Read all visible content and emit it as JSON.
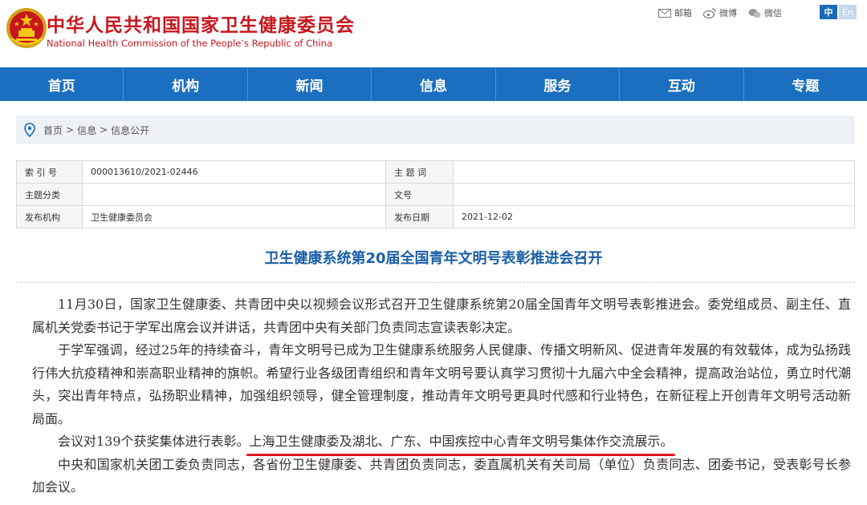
{
  "header": {
    "title_cn": "中华人民共和国国家卫生健康委员会",
    "title_en": "National Health Commission of the People’s Republic of China",
    "links": [
      {
        "label": "邮箱",
        "icon": "mail-icon"
      },
      {
        "label": "微博",
        "icon": "weibo-icon"
      },
      {
        "label": "微信",
        "icon": "wechat-icon"
      }
    ],
    "lang": {
      "cn": "中",
      "en": "En"
    }
  },
  "colors": {
    "brand_red": "#c8161d",
    "nav_blue": "#1b6fc0",
    "title_blue": "#1a5fa8",
    "highlight_red": "#e0141a"
  },
  "nav": [
    "首页",
    "机构",
    "新闻",
    "信息",
    "服务",
    "互动",
    "专题"
  ],
  "breadcrumb": {
    "items": [
      "首页",
      "信息",
      "信息公开"
    ],
    "sep": ">"
  },
  "info": {
    "index_label": "索 引 号",
    "index_value": "000013610/2021-02446",
    "subject_label": "主 题 词",
    "subject_value": "",
    "category_label": "主题分类",
    "category_value": "",
    "docno_label": "文号",
    "docno_value": "",
    "org_label": "发布机构",
    "org_value": "卫生健康委员会",
    "date_label": "发布日期",
    "date_value": "2021-12-02"
  },
  "article": {
    "title": "卫生健康系统第20届全国青年文明号表彰推进会召开",
    "p1": "11月30日，国家卫生健康委、共青团中央以视频会议形式召开卫生健康系统第20届全国青年文明号表彰推进会。委党组成员、副主任、直属机关党委书记于学军出席会议并讲话，共青团中央有关部门负责同志宣读表彰决定。",
    "p2": "于学军强调，经过25年的持续奋斗，青年文明号已成为卫生健康系统服务人民健康、传播文明新风、促进青年发展的有效载体，成为弘扬践行伟大抗疫精神和崇高职业精神的旗帜。希望行业各级团青组织和青年文明号要认真学习贯彻十九届六中全会精神，提高政治站位，勇立时代潮头，突出青年特点，弘扬职业精神，加强组织领导，健全管理制度，推动青年文明号更具时代感和行业特色，在新征程上开创青年文明号活动新局面。",
    "p3_lead": "会议对139个获奖集体进行表彰。",
    "p3_highlight": "上海卫生健康委及湖北、广东、中国疾控中心青年文明号集体作交流展示。",
    "p4": "中央和国家机关团工委负责同志，各省份卫生健康委、共青团负责同志，委直属机关有关司局（单位）负责同志、团委书记，受表彰号长参加会议。"
  }
}
